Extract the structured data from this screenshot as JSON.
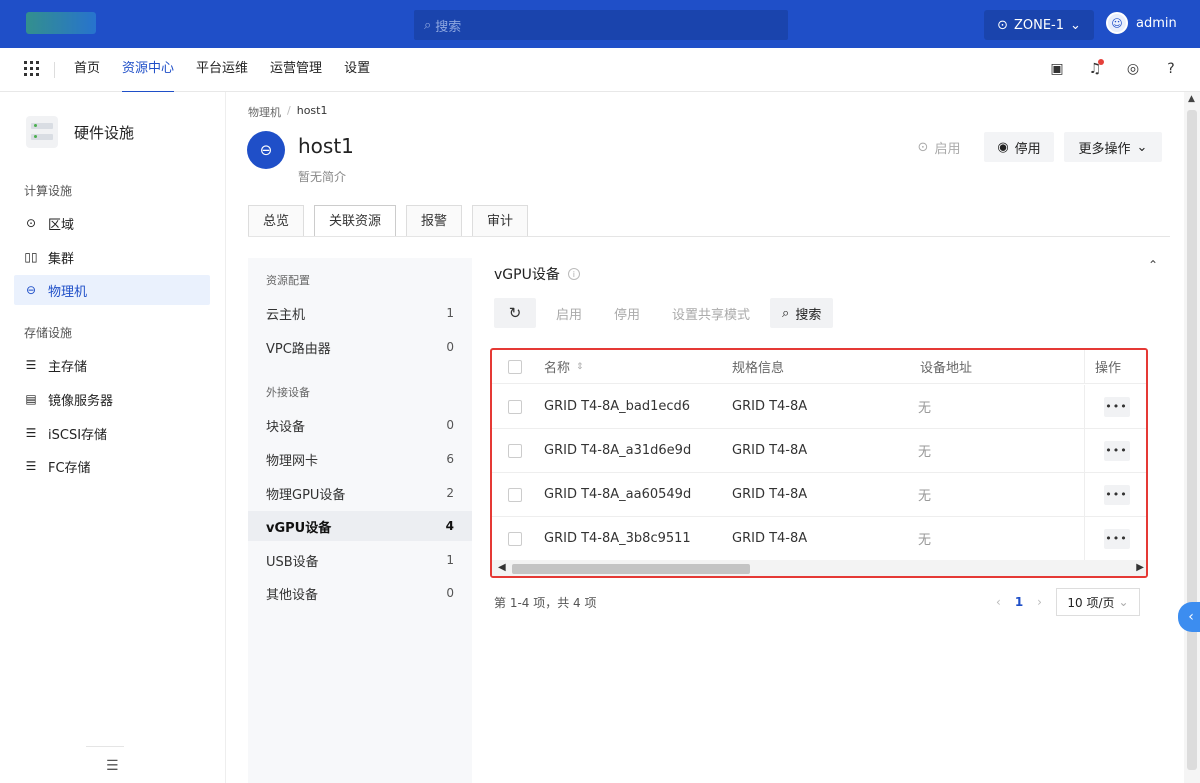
{
  "topbar": {
    "search_placeholder": "搜索",
    "zone": "ZONE-1",
    "user": "admin"
  },
  "nav": {
    "items": [
      "首页",
      "资源中心",
      "平台运维",
      "运营管理",
      "设置"
    ],
    "active_index": 1
  },
  "sidebar": {
    "title": "硬件设施",
    "group_compute": "计算设施",
    "compute_items": [
      {
        "label": "区域",
        "icon": "location-icon"
      },
      {
        "label": "集群",
        "icon": "cluster-icon"
      },
      {
        "label": "物理机",
        "icon": "host-icon",
        "active": true
      }
    ],
    "group_storage": "存储设施",
    "storage_items": [
      {
        "label": "主存储",
        "icon": "database-icon"
      },
      {
        "label": "镜像服务器",
        "icon": "server-icon"
      },
      {
        "label": "iSCSI存储",
        "icon": "database-icon"
      },
      {
        "label": "FC存储",
        "icon": "database-icon"
      }
    ]
  },
  "breadcrumb": {
    "parent": "物理机",
    "current": "host1"
  },
  "host": {
    "name": "host1",
    "desc": "暂无简介",
    "start_label": "启用",
    "stop_label": "停用",
    "more_label": "更多操作"
  },
  "tabs": [
    "总览",
    "关联资源",
    "报警",
    "审计"
  ],
  "resources": {
    "group_config": "资源配置",
    "config_items": [
      {
        "label": "云主机",
        "count": "1"
      },
      {
        "label": "VPC路由器",
        "count": "0"
      }
    ],
    "group_external": "外接设备",
    "external_items": [
      {
        "label": "块设备",
        "count": "0"
      },
      {
        "label": "物理网卡",
        "count": "6"
      },
      {
        "label": "物理GPU设备",
        "count": "2"
      },
      {
        "label": "vGPU设备",
        "count": "4",
        "active": true
      },
      {
        "label": "USB设备",
        "count": "1"
      },
      {
        "label": "其他设备",
        "count": "0"
      }
    ]
  },
  "content": {
    "title": "vGPU设备",
    "toolbar": {
      "start": "启用",
      "stop": "停用",
      "share_mode": "设置共享模式",
      "search": "搜索"
    },
    "columns": {
      "name": "名称",
      "spec": "规格信息",
      "address": "设备地址",
      "ops": "操作"
    },
    "rows": [
      {
        "name": "GRID T4-8A_bad1ecd6",
        "spec": "GRID T4-8A",
        "address": "无"
      },
      {
        "name": "GRID T4-8A_a31d6e9d",
        "spec": "GRID T4-8A",
        "address": "无"
      },
      {
        "name": "GRID T4-8A_aa60549d",
        "spec": "GRID T4-8A",
        "address": "无"
      },
      {
        "name": "GRID T4-8A_3b8c9511",
        "spec": "GRID T4-8A",
        "address": "无"
      }
    ],
    "more_glyph": "•••"
  },
  "pager": {
    "total": "第 1-4 项，共 4 项",
    "page": "1",
    "page_size": "10 项/页"
  },
  "colors": {
    "primary": "#1f4fc8",
    "highlight_border": "#e53935"
  }
}
